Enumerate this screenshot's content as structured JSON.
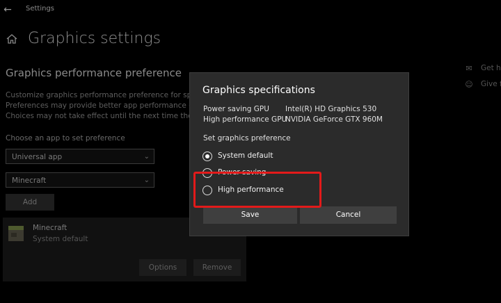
{
  "window": {
    "title": "Settings",
    "back_icon": "back-arrow-icon"
  },
  "page": {
    "title": "Graphics settings",
    "home_icon": "home-icon",
    "section_title": "Graphics performance preference",
    "description": [
      "Customize graphics performance preference for specific",
      "Preferences may provide better app performance or sav",
      "Choices may not take effect until the next time the app"
    ],
    "choose_label": "Choose an app to set preference",
    "app_type_value": "Universal app",
    "app_value": "Minecraft",
    "add_label": "Add",
    "app_card": {
      "name": "Minecraft",
      "preference": "System default",
      "options_label": "Options",
      "remove_label": "Remove"
    }
  },
  "side_links": [
    {
      "icon": "chat-help-icon",
      "label": "Get h"
    },
    {
      "icon": "feedback-person-icon",
      "label": "Give f"
    }
  ],
  "dialog": {
    "title": "Graphics specifications",
    "specs": [
      {
        "label": "Power saving GPU",
        "value": "Intel(R) HD Graphics 530"
      },
      {
        "label": "High performance GPU",
        "value": "NVIDIA GeForce GTX 960M"
      }
    ],
    "set_label": "Set graphics preference",
    "options": [
      {
        "label": "System default",
        "checked": true
      },
      {
        "label": "Power saving",
        "checked": false
      },
      {
        "label": "High performance",
        "checked": false
      }
    ],
    "save_label": "Save",
    "cancel_label": "Cancel"
  },
  "colors": {
    "highlight": "#e31a1a",
    "dialog_bg": "#2b2b2b",
    "button_bg": "#3f3f3f"
  }
}
